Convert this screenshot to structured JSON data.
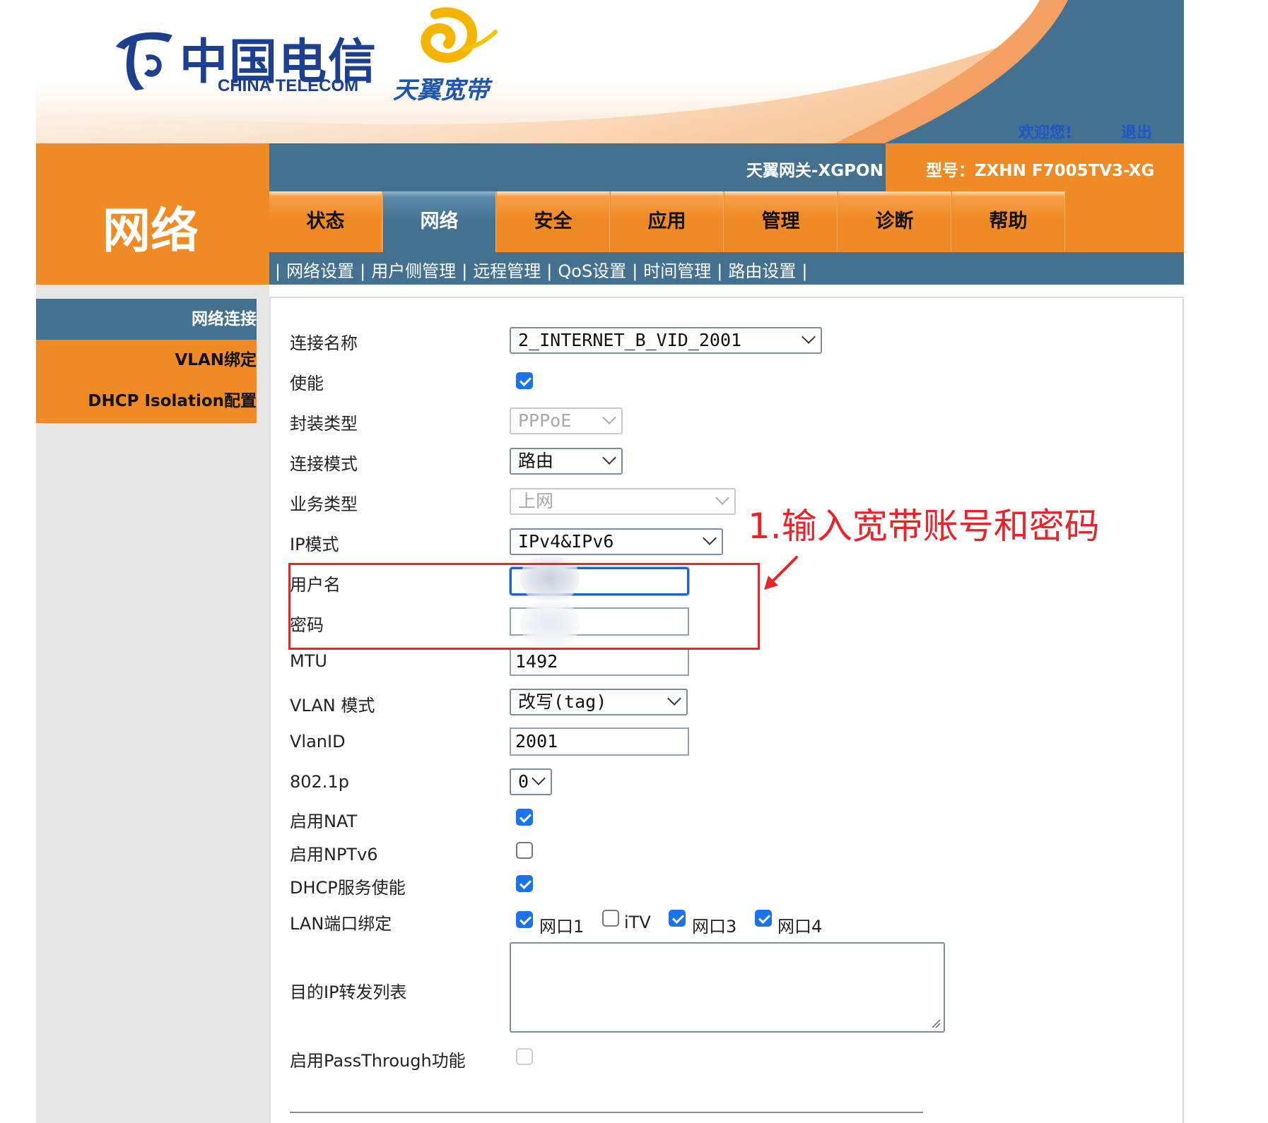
{
  "header": {
    "brand_cn": "中国电信",
    "brand_en": "CHINA TELECOM",
    "broadband_brand": "天翼宽带",
    "welcome": "欢迎您!",
    "logout": "退出",
    "gateway_name": "天翼网关-XGPON",
    "model": "型号：ZXHN F7005TV3-XG",
    "section_title": "网络"
  },
  "main_nav": {
    "tabs": [
      {
        "label": "状态",
        "active": false
      },
      {
        "label": "网络",
        "active": true
      },
      {
        "label": "安全",
        "active": false
      },
      {
        "label": "应用",
        "active": false
      },
      {
        "label": "管理",
        "active": false
      },
      {
        "label": "诊断",
        "active": false
      },
      {
        "label": "帮助",
        "active": false
      }
    ]
  },
  "sub_nav": {
    "items": [
      "网络设置",
      "用户侧管理",
      "远程管理",
      "QoS设置",
      "时间管理",
      "路由设置"
    ]
  },
  "side_menu": {
    "items": [
      {
        "label": "网络连接",
        "active": true
      },
      {
        "label": "VLAN绑定",
        "active": false
      },
      {
        "label": "DHCP Isolation配置",
        "active": false
      }
    ]
  },
  "form": {
    "connection_name": {
      "label": "连接名称",
      "value": "2_INTERNET_B_VID_2001"
    },
    "enable": {
      "label": "使能",
      "checked": true
    },
    "encap_type": {
      "label": "封装类型",
      "value": "PPPoE",
      "disabled": true
    },
    "conn_mode": {
      "label": "连接模式",
      "value": "路由"
    },
    "service_type": {
      "label": "业务类型",
      "value": "上网",
      "disabled": true
    },
    "ip_mode": {
      "label": "IP模式",
      "value": "IPv4&IPv6"
    },
    "username": {
      "label": "用户名",
      "value": ""
    },
    "password": {
      "label": "密码",
      "value": ""
    },
    "mtu": {
      "label": "MTU",
      "value": "1492"
    },
    "vlan_mode": {
      "label": "VLAN 模式",
      "value": "改写(tag)"
    },
    "vlan_id": {
      "label": "VlanID",
      "value": "2001"
    },
    "dot1p": {
      "label": "802.1p",
      "value": "0"
    },
    "nat": {
      "label": "启用NAT",
      "checked": true
    },
    "nptv6": {
      "label": "启用NPTv6",
      "checked": false
    },
    "dhcp": {
      "label": "DHCP服务使能",
      "checked": true
    },
    "lan_binding": {
      "label": "LAN端口绑定",
      "ports": [
        {
          "label": "网口1",
          "checked": true
        },
        {
          "label": "iTV",
          "checked": false
        },
        {
          "label": "网口3",
          "checked": true
        },
        {
          "label": "网口4",
          "checked": true
        }
      ]
    },
    "dest_ip_list": {
      "label": "目的IP转发列表",
      "value": ""
    },
    "passthrough": {
      "label": "启用PassThrough功能",
      "checked": false,
      "disabled": true
    }
  },
  "annotation": {
    "text": "1.输入宽带账号和密码",
    "color": "#e8232a"
  },
  "colors": {
    "orange": "#f08a24",
    "steel_blue": "#43718f",
    "link_blue": "#1c56c8",
    "checkbox_blue": "#1a73e8"
  }
}
